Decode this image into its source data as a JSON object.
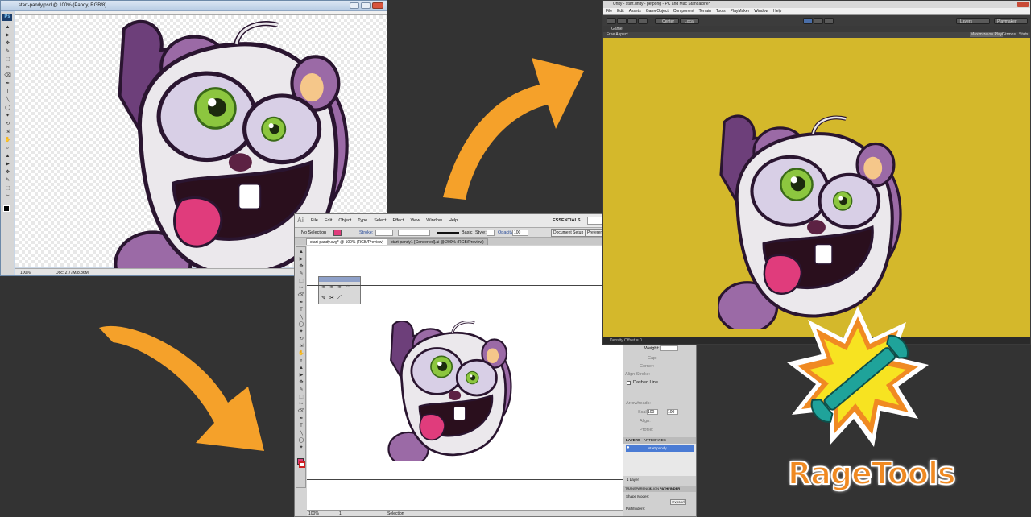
{
  "photoshop": {
    "title": "start-pandy.psd @ 100% (Pandy, RGB/8)",
    "logo": "Ps",
    "zoom": "100%",
    "doc_info": "Doc: 2.77M/8.86M"
  },
  "illustrator": {
    "logo": "Ai",
    "menu": [
      "File",
      "Edit",
      "Object",
      "Type",
      "Select",
      "Effect",
      "View",
      "Window",
      "Help"
    ],
    "workspace": "ESSENTIALS",
    "control": {
      "selection": "No Selection",
      "stroke_label": "Stroke:",
      "brush": "Basic",
      "style_label": "Style:",
      "opacity_label": "Opacity:",
      "opacity": "100",
      "doc_setup": "Document Setup",
      "preferences": "Preferences"
    },
    "tabs": [
      "start-pandy.svg* @ 100% (RGB/Preview)",
      "start-pandy1 [Converted].ai @ 200% (RGB/Preview)"
    ],
    "status_zoom": "100%",
    "status_page": "1",
    "status_tool": "Selection",
    "stroke_panel": {
      "weight_label": "Weight:",
      "cap_label": "Cap:",
      "corner_label": "Corner:",
      "align_label": "Align Stroke:",
      "dashed": "Dashed Line",
      "arrowheads": "Arrowheads:",
      "scale_label": "Scale:",
      "scale_val": "100",
      "align2_label": "Align:",
      "profile_label": "Profile:"
    },
    "layers": {
      "tab": "LAYERS",
      "tab2": "ARTBOARDS",
      "layer_name": "start-pandy",
      "count": "1 Layer"
    },
    "pathfinder": {
      "tab1": "TRANSPARENCY",
      "tab2": "ALIGN",
      "tab3": "PATHFINDER",
      "shape_modes": "Shape Modes:",
      "expand": "Expand",
      "pathfinders": "Pathfinders:"
    }
  },
  "unity": {
    "title": "Unity - start.unity - petpong - PC and Mac Standalone*",
    "menu": [
      "File",
      "Edit",
      "Assets",
      "GameObject",
      "Component",
      "Terrain",
      "Tools",
      "PlayMaker",
      "Window",
      "Help"
    ],
    "pivot": "Center",
    "space": "Local",
    "layers": "Layers",
    "layout": "Playmaker",
    "game_tab": "Game",
    "aspect": "Free Aspect",
    "maximize": "Maximize on Play",
    "gizmos": "Gizmos",
    "stats": "Stats",
    "status": "Density Offset = 0",
    "background": "#d4b82b"
  },
  "brand": {
    "name": "RageTools",
    "colors": {
      "orange": "#f5a12a",
      "teal": "#1fa39a",
      "burst": "#f7e321"
    }
  },
  "arrows": {
    "color": "#f5a12a"
  }
}
